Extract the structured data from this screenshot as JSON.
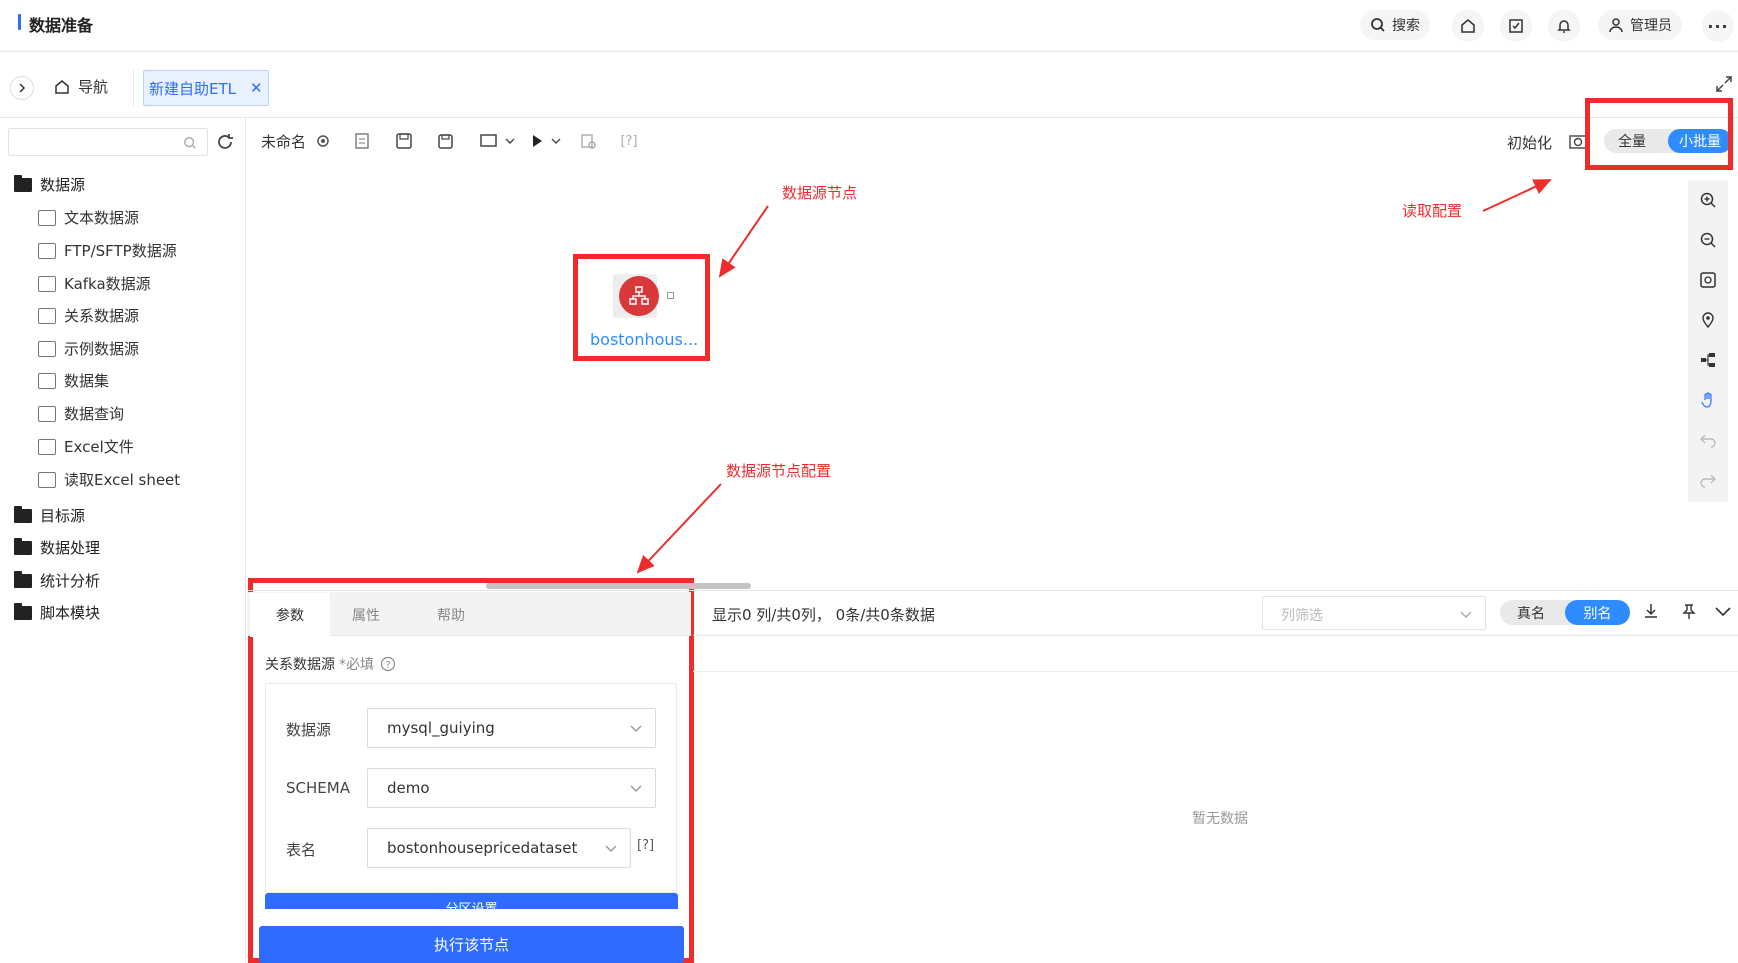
{
  "app": {
    "title": "数据准备"
  },
  "topbar": {
    "search_label": "搜索",
    "user_label": "管理员"
  },
  "tabs": {
    "nav_label": "导航",
    "etl_label": "新建自助ETL"
  },
  "sidebar": {
    "folders": [
      "数据源",
      "目标源",
      "数据处理",
      "统计分析",
      "脚本模块"
    ],
    "datasource_items": [
      "文本数据源",
      "FTP/SFTP数据源",
      "Kafka数据源",
      "关系数据源",
      "示例数据源",
      "数据集",
      "数据查询",
      "Excel文件",
      "读取Excel sheet"
    ]
  },
  "toolbar": {
    "name": "未命名",
    "init_label": "初始化",
    "full_label": "全量",
    "small_batch_label": "小批量"
  },
  "canvas": {
    "node_label": "bostonhous..."
  },
  "annotations": {
    "node": "数据源节点",
    "read_config": "读取配置",
    "node_config": "数据源节点配置"
  },
  "panel": {
    "tabs": [
      "参数",
      "属性",
      "帮助"
    ],
    "section_label": "关系数据源",
    "required": "*必填",
    "fields": [
      {
        "label": "数据源",
        "value": "mysql_guiying"
      },
      {
        "label": "SCHEMA",
        "value": "demo"
      },
      {
        "label": "表名",
        "value": "bostonhousepricedataset"
      }
    ],
    "partition_label": "分区设置",
    "run_button": "执行该节点"
  },
  "preview": {
    "stats": "显示0 列/共0列， 0条/共0条数据",
    "column_filter_placeholder": "列筛选",
    "real_name": "真名",
    "alias": "别名",
    "empty": "暂无数据"
  },
  "colors": {
    "accent": "#2f6bff",
    "toggle_blue": "#2f8cff",
    "annotation_red": "#ee2c2c",
    "node_red": "#d9383a"
  }
}
